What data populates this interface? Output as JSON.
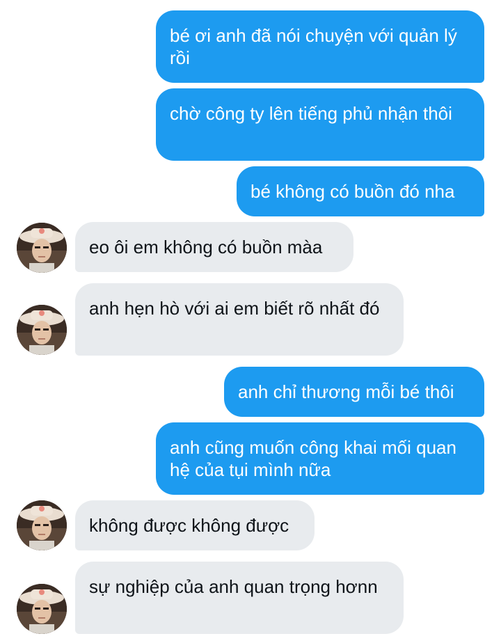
{
  "conversation": {
    "messages": [
      {
        "side": "out",
        "text": "bé ơi anh đã nói chuyện với quản lý rồi"
      },
      {
        "side": "out",
        "text": "chờ công ty lên tiếng phủ nhận thôi"
      },
      {
        "side": "out",
        "text": "bé không có buồn đó nha"
      },
      {
        "side": "in",
        "text": "eo ôi em không có buồn màa"
      },
      {
        "side": "in",
        "text": "anh hẹn hò với ai em biết rõ nhất đó"
      },
      {
        "side": "out",
        "text": "anh chỉ thương mỗi bé thôi"
      },
      {
        "side": "out",
        "text": "anh cũng muốn công khai mối quan hệ của tụi mình nữa"
      },
      {
        "side": "in",
        "text": "không được không được"
      },
      {
        "side": "in",
        "text": "sự nghiệp của anh quan trọng hơnn"
      }
    ]
  },
  "colors": {
    "outgoing_bubble": "#1d9bf0",
    "incoming_bubble": "#e8ebee",
    "outgoing_text": "#ffffff",
    "incoming_text": "#0f1419"
  },
  "icons": {
    "avatar": "contact-avatar"
  }
}
